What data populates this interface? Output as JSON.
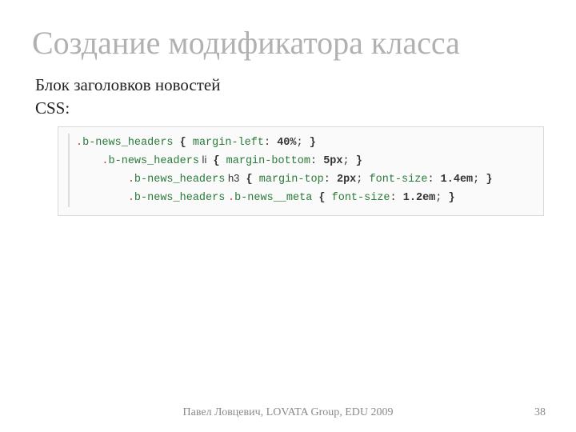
{
  "title": "Создание модификатора класса",
  "subtitle": "Блок заголовков новостей",
  "subtitle2": "CSS:",
  "code": {
    "lines": [
      {
        "indent": "",
        "sel_dot": ".",
        "sel_name": "b-news_headers",
        "sel_el": "",
        "sel2_dot": "",
        "sel2_name": "",
        "decl": [
          {
            "prop": "margin-left",
            "val": "40%"
          }
        ]
      },
      {
        "indent": "    ",
        "sel_dot": ".",
        "sel_name": "b-news_headers",
        "sel_el": " li",
        "sel2_dot": "",
        "sel2_name": "",
        "decl": [
          {
            "prop": "margin-bottom",
            "val": "5px"
          }
        ]
      },
      {
        "indent": "        ",
        "sel_dot": ".",
        "sel_name": "b-news_headers",
        "sel_el": " h3",
        "sel2_dot": "",
        "sel2_name": "",
        "decl": [
          {
            "prop": "margin-top",
            "val": "2px"
          },
          {
            "prop": "font-size",
            "val": "1.4em"
          }
        ]
      },
      {
        "indent": "        ",
        "sel_dot": ".",
        "sel_name": "b-news_headers",
        "sel_el": " ",
        "sel2_dot": ".",
        "sel2_name": "b-news__meta",
        "decl": [
          {
            "prop": "font-size",
            "val": "1.2em"
          }
        ]
      }
    ]
  },
  "footer": "Павел Ловцевич, LOVATA Group, EDU 2009",
  "page": "38"
}
